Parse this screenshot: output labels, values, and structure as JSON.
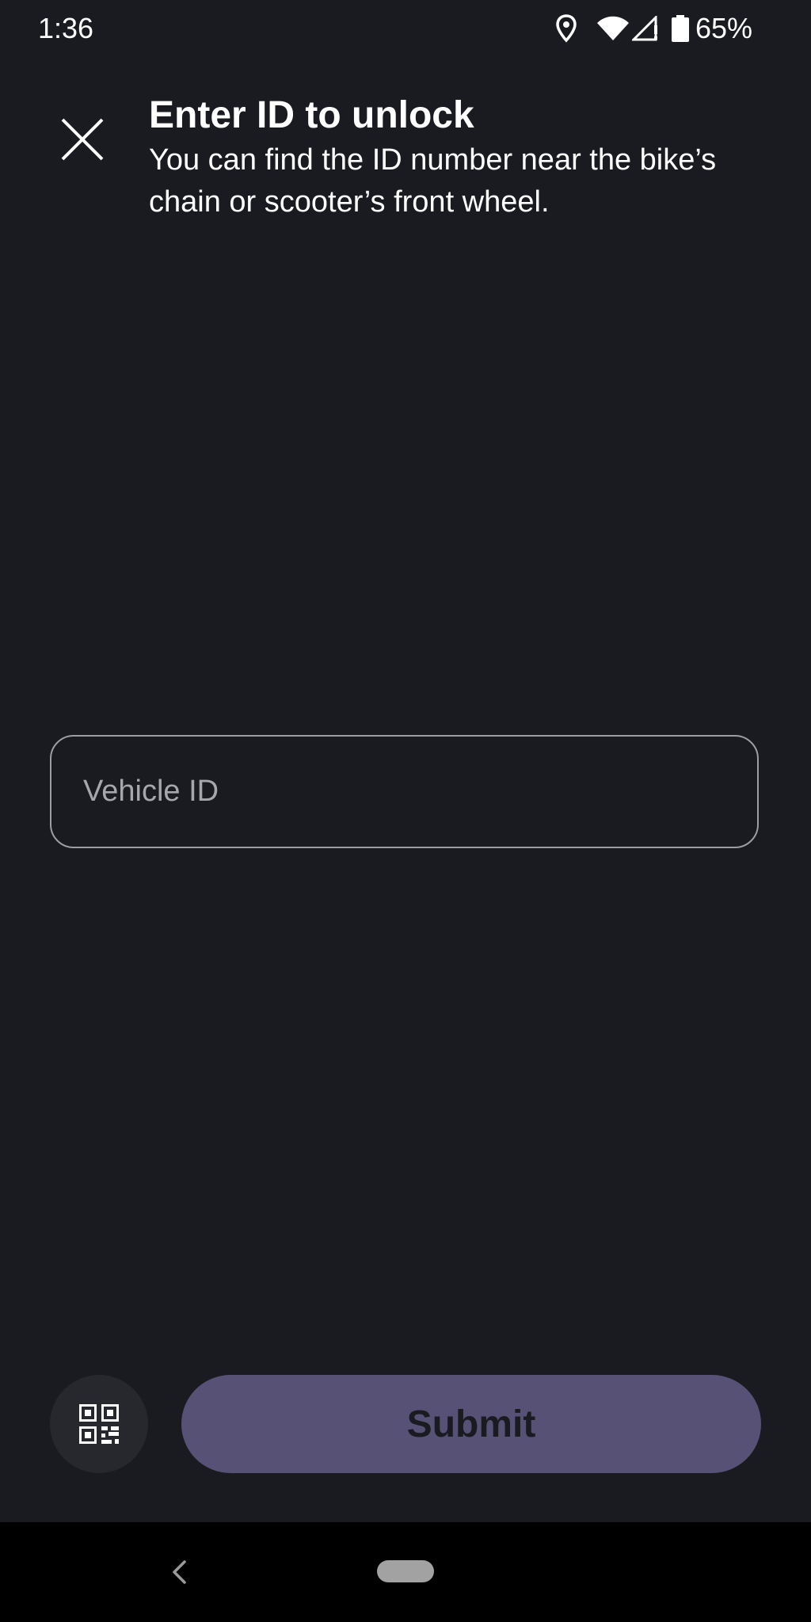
{
  "status_bar": {
    "time": "1:36",
    "battery_percent": "65%",
    "icons": [
      "location-icon",
      "wifi-icon",
      "cell-signal-icon",
      "battery-icon"
    ]
  },
  "header": {
    "close_icon": "close-icon",
    "title": "Enter ID to unlock",
    "subtitle": "You can find the ID number near the bike’s chain or scooter’s front wheel."
  },
  "form": {
    "vehicle_id_placeholder": "Vehicle ID",
    "vehicle_id_value": ""
  },
  "actions": {
    "qr_icon": "qr-code-icon",
    "submit_label": "Submit"
  },
  "nav_bar": {
    "back_icon": "back-chevron-icon",
    "home_icon": "home-pill"
  },
  "colors": {
    "background": "#1a1b21",
    "submit_button": "#575275",
    "qr_button": "#27282e",
    "input_border": "#9d9da3",
    "nav_background": "#000000"
  }
}
